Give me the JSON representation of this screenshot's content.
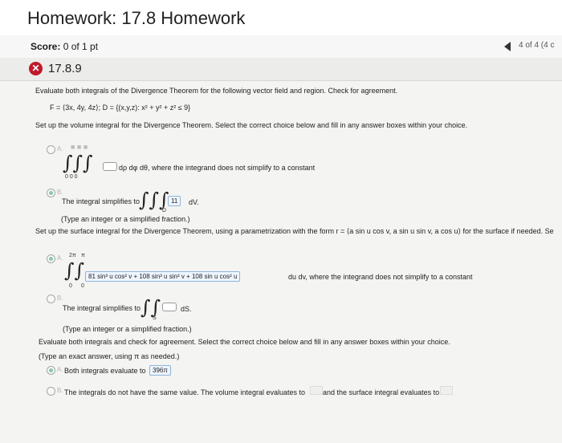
{
  "title": "Homework: 17.8 Homework",
  "score_label": "Score:",
  "score_value": "0 of 1 pt",
  "nav_count": "4 of 4 (4 c",
  "question_number": "17.8.9",
  "prompt_line": "Evaluate both integrals of the Divergence Theorem for the following vector field and region. Check for agreement.",
  "field_line": "F = ⟨3x, 4y, 4z⟩;   D = {(x,y,z): x² + y² + z² ≤ 9}",
  "setup_volume": "Set up the volume integral for the Divergence Theorem. Select the correct choice below and fill in any answer boxes within your choice.",
  "vol_A_label": "A.",
  "vol_A_text": "dρ dφ dθ, where the integrand does not simplify to a constant",
  "vol_B_label": "B.",
  "vol_B_text": "The integral simplifies to",
  "vol_B_value": "11",
  "vol_B_dv": "dV.",
  "vol_B_D": "D",
  "vol_B_note": "(Type an integer or a simplified fraction.)",
  "setup_surface": "Set up the surface integral for the Divergence Theorem, using a parametrization with the form r = ⟨a sin u cos v, a sin u sin v, a cos u⟩ for the surface if needed. Se",
  "surf_A_label": "A.",
  "surf_A_upper_outer": "2π",
  "surf_A_upper_inner": "π",
  "surf_A_lower_outer": "0",
  "surf_A_lower_inner": "0",
  "surf_A_integrand": "81 sin³ u cos² v + 108 sin³ u sin² v + 108 sin u cos² u",
  "surf_A_text": "du dv, where the integrand does not simplify to a constant",
  "surf_B_label": "B.",
  "surf_B_text": "The integral simplifies to",
  "surf_B_ds": "dS.",
  "surf_B_S": "S",
  "surf_B_note": "(Type an integer or a simplified fraction.)",
  "evaluate_line": "Evaluate both integrals and check for agreement. Select the correct choice below and fill in any answer boxes within your choice.",
  "evaluate_note": "(Type an exact answer, using π as needed.)",
  "final_A_label": "A.",
  "final_A_text": "Both integrals evaluate to",
  "final_A_value": "396π",
  "final_B_label": "B.",
  "final_B_text": "The integrals do not have the same value. The volume integral evaluates to",
  "final_B_text2": "and the surface integral evaluates to",
  "colors": {
    "accent_red": "#c0192b",
    "selected_radio": "#88c7b5",
    "box_border": "#8fb4d9"
  },
  "icons": {
    "status": "x-icon",
    "nav": "chevron-left-icon"
  }
}
